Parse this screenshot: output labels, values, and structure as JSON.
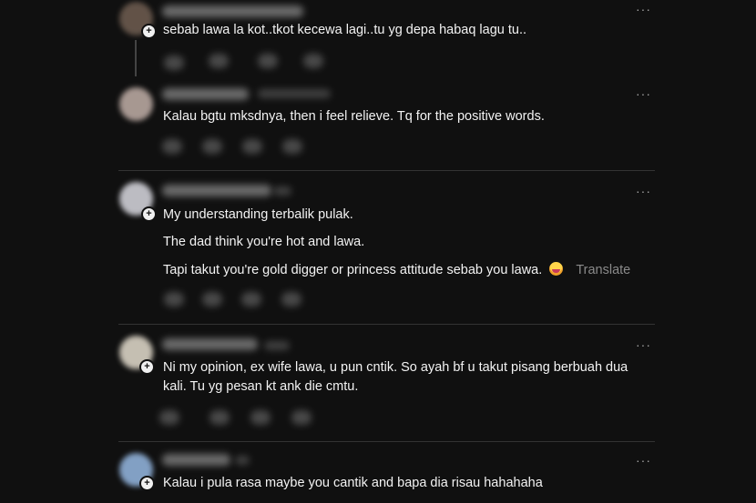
{
  "comments": [
    {
      "text": "sebab lawa la kot..tkot kecewa lagi..tu yg depa habaq lagu tu.."
    },
    {
      "text": "Kalau bgtu mksdnya, then i feel relieve. Tq for the positive words."
    },
    {
      "lines": [
        "My understanding terbalik pulak.",
        "The dad think you're hot and lawa.",
        "Tapi takut you're gold digger or princess attitude sebab you lawa."
      ],
      "translate_label": "Translate"
    },
    {
      "lines": [
        "Ni my opinion, ex wife lawa, u pun cntik. So ayah bf u takut pisang berbuah dua",
        "kali. Tu yg pesan kt ank die cmtu."
      ]
    },
    {
      "text": "Kalau i pula rasa maybe you cantik and bapa dia risau hahahaha"
    }
  ],
  "more_label": "···",
  "badge_icon": "+",
  "avatar_colors": [
    "#6b5a4e",
    "#b8a7a0",
    "#cfcfd6",
    "#d9d2c4",
    "#8fb0d8"
  ]
}
